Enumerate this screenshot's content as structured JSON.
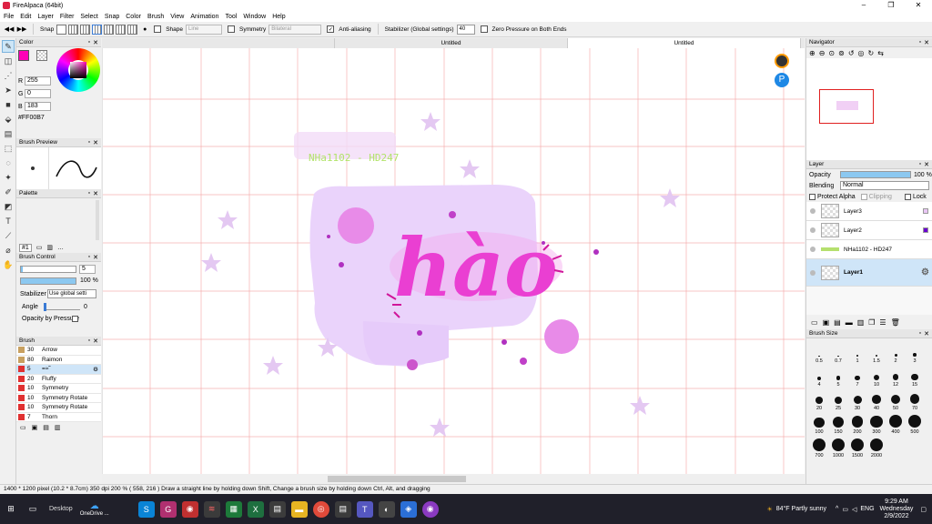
{
  "window": {
    "title": "FireAlpaca (64bit)",
    "controls": [
      "–",
      "❐",
      "✕"
    ]
  },
  "menu": [
    "File",
    "Edit",
    "Layer",
    "Filter",
    "Select",
    "Snap",
    "Color",
    "Brush",
    "View",
    "Animation",
    "Tool",
    "Window",
    "Help"
  ],
  "toolbar": {
    "snap_label": "Snap",
    "shape_label": "Shape",
    "shape_value": "Line",
    "symmetry_label": "Symmetry",
    "symmetry_value": "Bilateral",
    "antialias_label": "Anti-aliasing",
    "stabilizer_label": "Stabilizer (Global settings)",
    "stabilizer_value": "40",
    "zero_pressure_label": "Zero Pressure on Both Ends"
  },
  "color_panel": {
    "title": "Color",
    "r_label": "R",
    "r": "255",
    "g_label": "G",
    "g": "0",
    "b_label": "B",
    "b": "183",
    "hex": "#FF00B7",
    "main_color": "#ff00b7"
  },
  "brush_preview": {
    "title": "Brush Preview"
  },
  "palette": {
    "title": "Palette",
    "selector": "#1"
  },
  "brush_control": {
    "title": "Brush Control",
    "size": "5",
    "opacity": "100 %",
    "stabilizer_label": "Stabilizer",
    "stabilizer_value": "Use global setti",
    "angle_label": "Angle",
    "angle_value": "0",
    "pressure_label": "Opacity by Pressure"
  },
  "brush_list": {
    "title": "Brush",
    "items": [
      {
        "size": "30",
        "name": "Arrow",
        "color": "#c8a060"
      },
      {
        "size": "80",
        "name": "Raimon",
        "color": "#c8a060"
      },
      {
        "size": "5",
        "name": "=≈˜",
        "color": "#e03030"
      },
      {
        "size": "20",
        "name": "Fluffy",
        "color": "#e03030"
      },
      {
        "size": "10",
        "name": "Symmetry",
        "color": "#e03030"
      },
      {
        "size": "10",
        "name": "Symmetry Rotate",
        "color": "#e03030"
      },
      {
        "size": "10",
        "name": "Symmetry Rotate",
        "color": "#e03030"
      },
      {
        "size": "7",
        "name": "Thorn",
        "color": "#e03030"
      }
    ]
  },
  "tabs": [
    "",
    "Untitled",
    "Untitled"
  ],
  "canvas": {
    "watermark": "NHa1102 - HD247",
    "lettering": "hào"
  },
  "navigator": {
    "title": "Navigator"
  },
  "layers": {
    "title": "Layer",
    "opacity_label": "Opacity",
    "opacity_value": "100 %",
    "blending_label": "Blending",
    "blending_value": "Normal",
    "protect_alpha": "Protect Alpha",
    "clipping": "Clipping",
    "lock": "Lock",
    "items": [
      {
        "name": "Layer3"
      },
      {
        "name": "Layer2"
      },
      {
        "name": "NHa1102 - HD247"
      },
      {
        "name": "Layer1"
      }
    ]
  },
  "brush_size": {
    "title": "Brush Size",
    "sizes": [
      "0.5",
      "0.7",
      "1",
      "1.5",
      "2",
      "3",
      "4",
      "5",
      "7",
      "10",
      "12",
      "15",
      "20",
      "25",
      "30",
      "40",
      "50",
      "70",
      "100",
      "150",
      "200",
      "300",
      "400",
      "500",
      "700",
      "1000",
      "1500",
      "2000"
    ]
  },
  "status": "1400 * 1200 pixel   (10.2 * 8.7cm)   350 dpi   200 %   ( 558, 216 )   Draw a straight line by holding down Shift, Change a brush size by holding down Ctrl, Alt, and dragging",
  "taskbar": {
    "desktop": "Desktop",
    "onedrive": "OneDrive ...",
    "weather": "84°F  Partly sunny",
    "lang": "ENG",
    "time": "9:29 AM",
    "day": "Wednesday",
    "date": "2/9/2022"
  }
}
